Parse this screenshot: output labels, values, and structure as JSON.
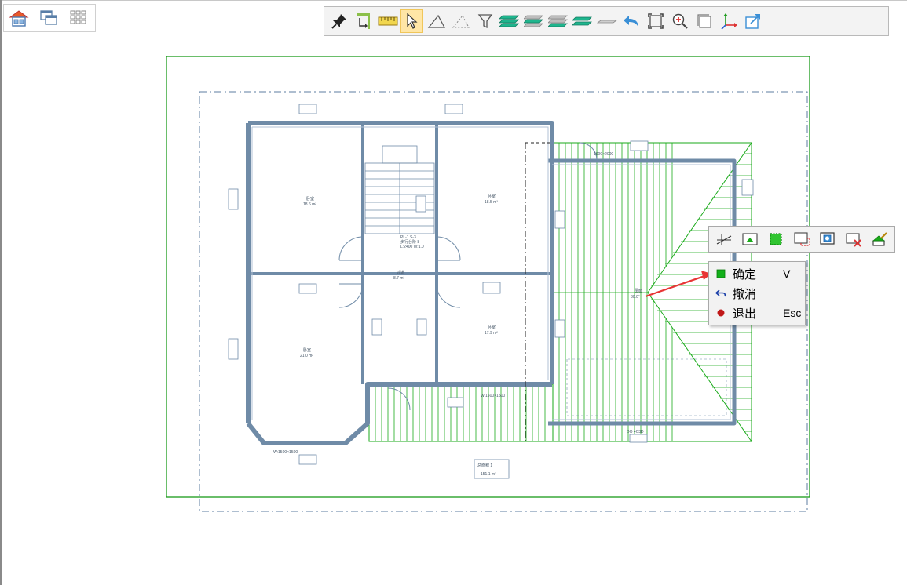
{
  "top_left_views": [
    {
      "icon": "home-view-icon"
    },
    {
      "icon": "windows-view-icon"
    },
    {
      "icon": "grid-view-icon"
    }
  ],
  "toolbar": {
    "tools": [
      {
        "icon": "pin-icon"
      },
      {
        "icon": "rotate-corner-icon"
      },
      {
        "icon": "ruler-icon"
      },
      {
        "icon": "select-arrow-icon",
        "active": true
      },
      {
        "icon": "triangle-icon"
      },
      {
        "icon": "dashed-triangle-icon"
      },
      {
        "icon": "filter-icon"
      },
      {
        "icon": "layers-green-icon"
      },
      {
        "icon": "layers-gray-green-icon"
      },
      {
        "icon": "layers-top-green-icon"
      },
      {
        "icon": "layers-two-icon"
      },
      {
        "icon": "plane-icon"
      },
      {
        "icon": "undo-arrow-icon"
      },
      {
        "icon": "zoom-extents-icon"
      },
      {
        "icon": "zoom-in-icon"
      },
      {
        "icon": "box-icon"
      },
      {
        "icon": "axes-icon"
      },
      {
        "icon": "export-icon"
      }
    ]
  },
  "plan": {
    "rooms": [
      {
        "name": "卧室",
        "area": "18.6 m²"
      },
      {
        "name": "卧室",
        "area": "18.5 m²"
      },
      {
        "name": "过道",
        "area": "8.7 m²"
      },
      {
        "name": "卧室",
        "area": "21.0 m²"
      },
      {
        "name": "卧室",
        "area": "17.9 m²"
      }
    ],
    "area_tag_title": "总面积 1",
    "area_tag_value": "151.1 m²",
    "window_tag": "W:1500×1500",
    "window_tag_2": "W:1500×1500",
    "stair_label_1": "PL-1 S-3",
    "stair_label_2": "步行台阶 8",
    "stair_label_3": "L:2400 W:1.0",
    "roof_label": "屋面",
    "roof_value": "30.0°",
    "opening_tag": "1000×2000",
    "bottom_tag": "DO 4C3D"
  },
  "mini_toolbar": {
    "tools": [
      {
        "icon": "axis-draw-icon"
      },
      {
        "icon": "picture-arrow-icon"
      },
      {
        "icon": "green-dotted-select-icon"
      },
      {
        "icon": "red-dotted-corner-icon"
      },
      {
        "icon": "blue-window-icon"
      },
      {
        "icon": "remove-picture-icon"
      },
      {
        "icon": "roof-brush-icon"
      }
    ]
  },
  "context_menu": {
    "items": [
      {
        "label": "确定",
        "key": "V",
        "icon": "confirm-green-square-icon"
      },
      {
        "label": "撤消",
        "key": "",
        "icon": "undo-blue-arrow-icon"
      },
      {
        "label": "退出",
        "key": "Esc",
        "icon": "exit-red-dot-icon"
      }
    ]
  },
  "colors": {
    "wall": "#6f8ba7",
    "roof": "#1aaa1a",
    "page_border": "#1a9a1a",
    "dash_border": "#5d7ea0",
    "arrow": "#e83535"
  }
}
